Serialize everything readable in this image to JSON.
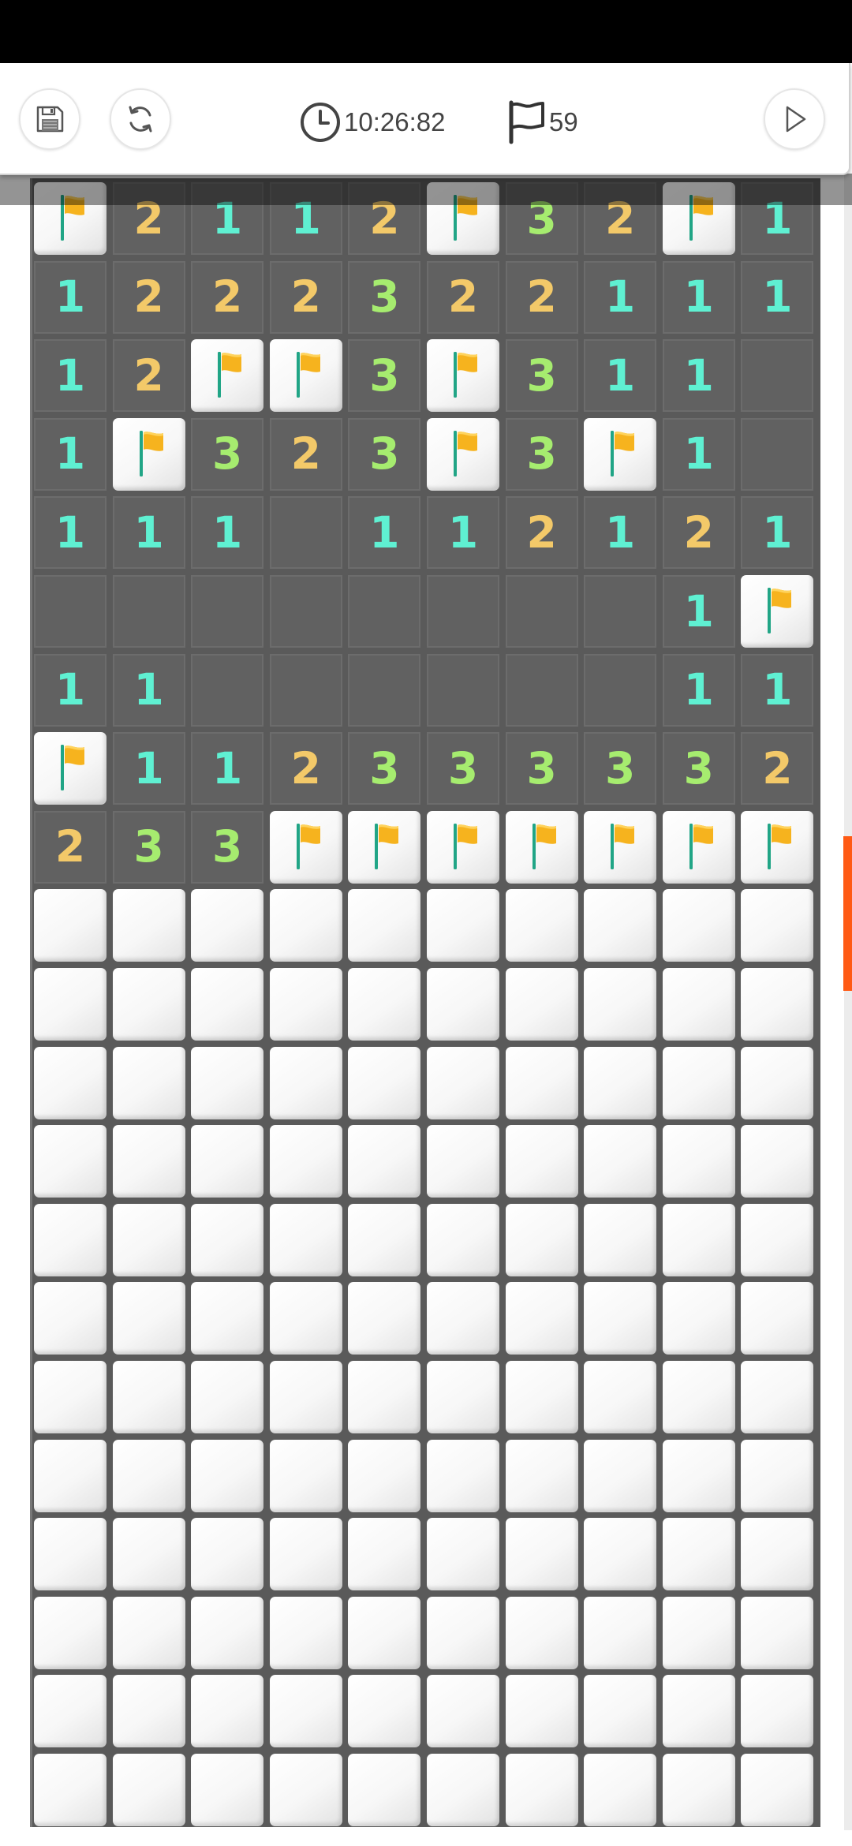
{
  "toolbar": {
    "save_icon": "floppy-disk-icon",
    "restart_icon": "refresh-icon",
    "timer_icon": "clock-icon",
    "timer": "10:26:82",
    "flags_icon": "flag-outline-icon",
    "flags_remaining": "59",
    "play_icon": "play-icon"
  },
  "board": {
    "columns": 10,
    "legend": {
      "F": "flag",
      "H": "hidden",
      "E": "revealed-empty"
    },
    "number_colors": {
      "1": "#5ff0d2",
      "2": "#f3c969",
      "3": "#a6ec6f"
    },
    "rows": [
      [
        "F",
        "2",
        "1",
        "1",
        "2",
        "F",
        "3",
        "2",
        "F",
        "1"
      ],
      [
        "1",
        "2",
        "2",
        "2",
        "3",
        "2",
        "2",
        "1",
        "1",
        "1"
      ],
      [
        "1",
        "2",
        "F",
        "F",
        "3",
        "F",
        "3",
        "1",
        "1",
        "E"
      ],
      [
        "1",
        "F",
        "3",
        "2",
        "3",
        "F",
        "3",
        "F",
        "1",
        "E"
      ],
      [
        "1",
        "1",
        "1",
        "E",
        "1",
        "1",
        "2",
        "1",
        "2",
        "1"
      ],
      [
        "E",
        "E",
        "E",
        "E",
        "E",
        "E",
        "E",
        "E",
        "1",
        "F"
      ],
      [
        "1",
        "1",
        "E",
        "E",
        "E",
        "E",
        "E",
        "E",
        "1",
        "1"
      ],
      [
        "F",
        "1",
        "1",
        "2",
        "3",
        "3",
        "3",
        "3",
        "3",
        "2"
      ],
      [
        "2",
        "3",
        "3",
        "F",
        "F",
        "F",
        "F",
        "F",
        "F",
        "F"
      ],
      [
        "H",
        "H",
        "H",
        "H",
        "H",
        "H",
        "H",
        "H",
        "H",
        "H"
      ],
      [
        "H",
        "H",
        "H",
        "H",
        "H",
        "H",
        "H",
        "H",
        "H",
        "H"
      ],
      [
        "H",
        "H",
        "H",
        "H",
        "H",
        "H",
        "H",
        "H",
        "H",
        "H"
      ],
      [
        "H",
        "H",
        "H",
        "H",
        "H",
        "H",
        "H",
        "H",
        "H",
        "H"
      ],
      [
        "H",
        "H",
        "H",
        "H",
        "H",
        "H",
        "H",
        "H",
        "H",
        "H"
      ],
      [
        "H",
        "H",
        "H",
        "H",
        "H",
        "H",
        "H",
        "H",
        "H",
        "H"
      ],
      [
        "H",
        "H",
        "H",
        "H",
        "H",
        "H",
        "H",
        "H",
        "H",
        "H"
      ],
      [
        "H",
        "H",
        "H",
        "H",
        "H",
        "H",
        "H",
        "H",
        "H",
        "H"
      ],
      [
        "H",
        "H",
        "H",
        "H",
        "H",
        "H",
        "H",
        "H",
        "H",
        "H"
      ],
      [
        "H",
        "H",
        "H",
        "H",
        "H",
        "H",
        "H",
        "H",
        "H",
        "H"
      ],
      [
        "H",
        "H",
        "H",
        "H",
        "H",
        "H",
        "H",
        "H",
        "H",
        "H"
      ],
      [
        "H",
        "H",
        "H",
        "H",
        "H",
        "H",
        "H",
        "H",
        "H",
        "H"
      ]
    ]
  }
}
